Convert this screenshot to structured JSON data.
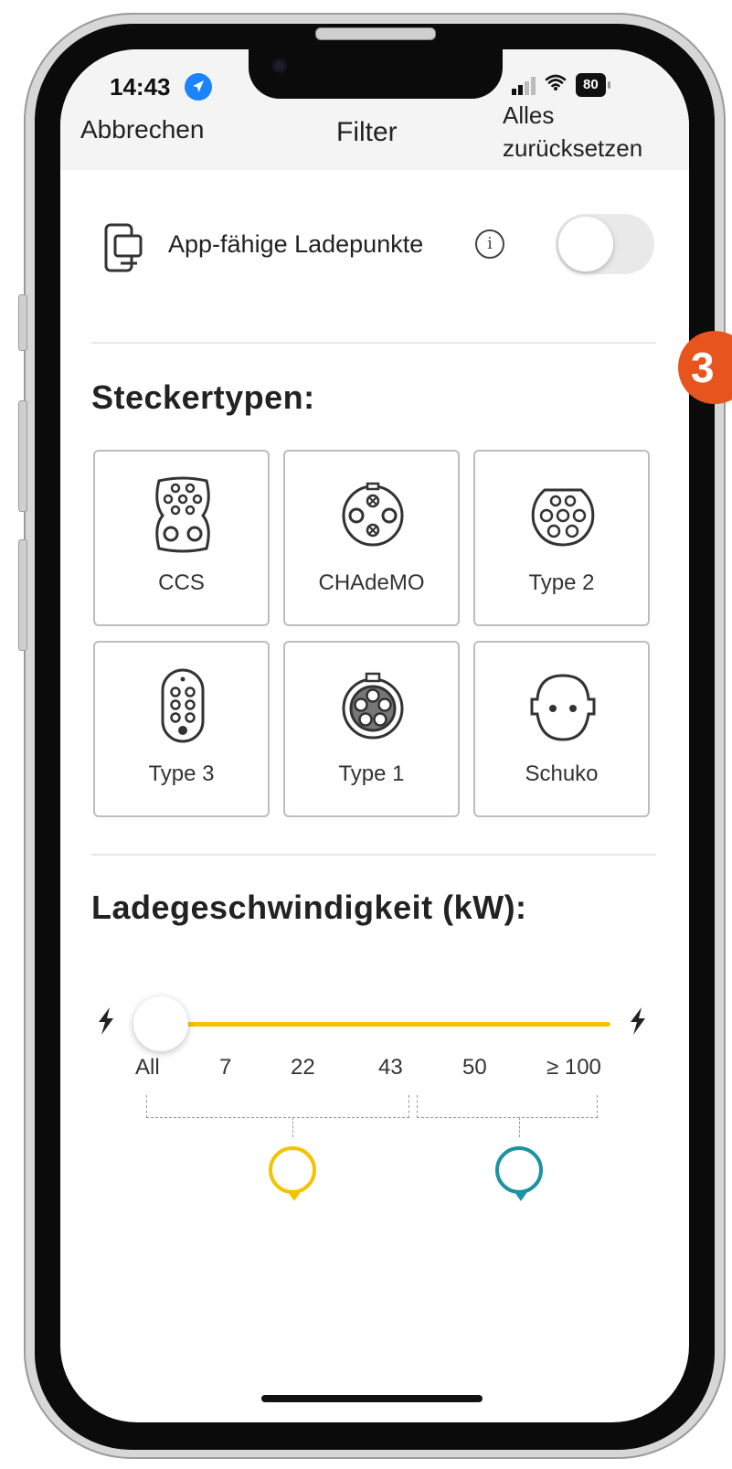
{
  "status_bar": {
    "time": "14:43",
    "battery": "80",
    "icons": [
      "location-arrow-icon",
      "cellular-signal-icon",
      "wifi-icon",
      "battery-icon"
    ]
  },
  "nav": {
    "cancel": "Abbrechen",
    "title": "Filter",
    "reset": "Alles zurücksetzen"
  },
  "app_toggle": {
    "label": "App-fähige Ladepunkte",
    "info": "i",
    "enabled": false
  },
  "plug_section": {
    "title": "Steckertypen:",
    "plugs": [
      {
        "label": "CCS",
        "icon": "ccs-plug-icon"
      },
      {
        "label": "CHAdeMO",
        "icon": "chademo-plug-icon"
      },
      {
        "label": "Type 2",
        "icon": "type2-plug-icon"
      },
      {
        "label": "Type 3",
        "icon": "type3-plug-icon"
      },
      {
        "label": "Type 1",
        "icon": "type1-plug-icon"
      },
      {
        "label": "Schuko",
        "icon": "schuko-plug-icon"
      }
    ]
  },
  "speed_section": {
    "title": "Ladegeschwindigkeit (kW):",
    "ticks": [
      "All",
      "7",
      "22",
      "43",
      "50",
      "≥ 100"
    ],
    "selected_index": 0,
    "colors": {
      "track": "#f2c400",
      "ac_pin": "#f2c400",
      "dc_pin": "#1a93a3"
    }
  },
  "overlay": {
    "badge_text": "3",
    "badge_color": "#e8541e"
  }
}
